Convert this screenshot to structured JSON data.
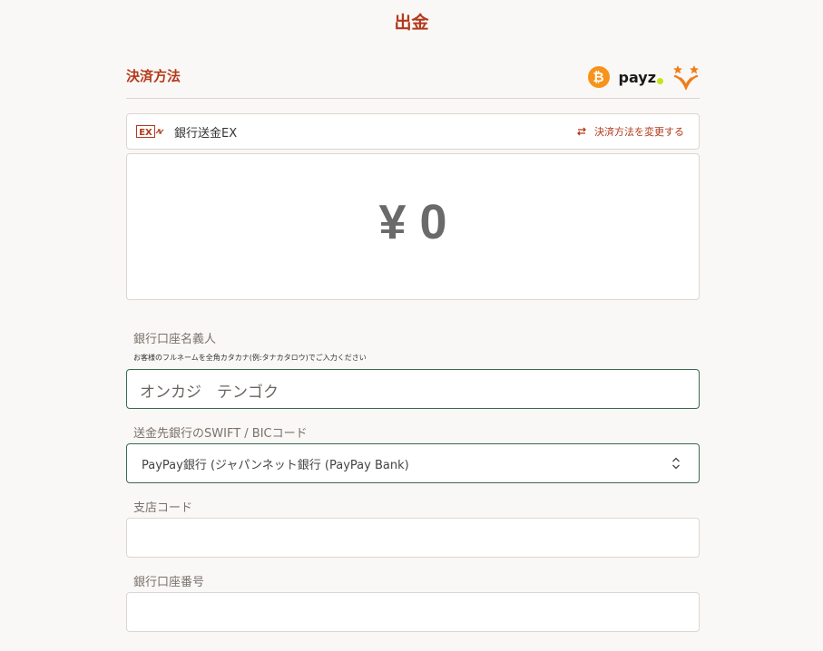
{
  "page": {
    "title": "出金"
  },
  "payment": {
    "section_title": "決済方法",
    "logos": [
      "bitcoin-icon",
      "payz-logo",
      "stars-logo"
    ],
    "payz_text": "payz",
    "btc_symbol": "₿",
    "ex_logo_text": "EX",
    "method_name": "銀行送金EX",
    "change_label": "決済方法を変更する"
  },
  "amount": {
    "display": "¥ 0"
  },
  "fields": {
    "account_name": {
      "label": "銀行口座名義人",
      "hint": "お客様のフルネームを全角カタカナ(例:タナカタロウ)でご入力ください",
      "value": "オンカジ　テンゴク"
    },
    "swift": {
      "label": "送金先銀行のSWIFT / BICコード",
      "selected": "PayPay銀行 (ジャパンネット銀行 (PayPay Bank)"
    },
    "branch_code": {
      "label": "支店コード",
      "value": "",
      "placeholder": ""
    },
    "account_number": {
      "label": "銀行口座番号",
      "value": "",
      "placeholder": ""
    }
  },
  "colors": {
    "accent": "#b23a1c",
    "focus_border": "#3a6b4e",
    "background": "#faf8f6",
    "bitcoin": "#f7931a",
    "payz_dot": "#c6e31a",
    "stars": "#ef7d1a"
  }
}
